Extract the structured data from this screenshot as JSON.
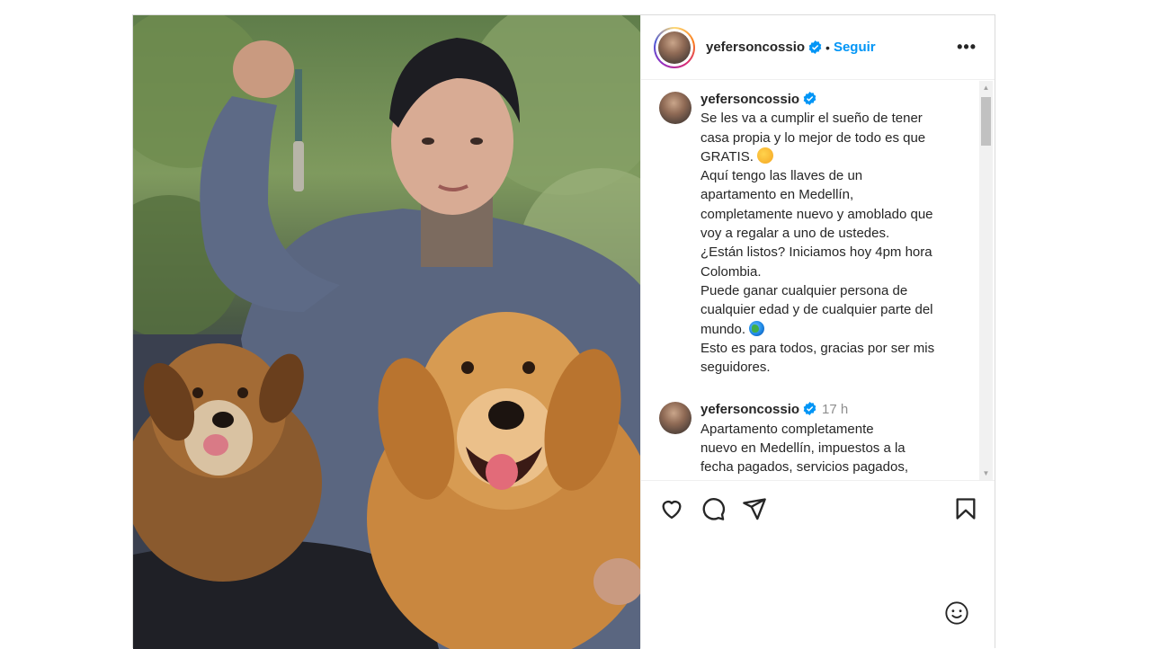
{
  "post": {
    "header": {
      "username": "yefersoncossio",
      "separator": "•",
      "follow_label": "Seguir",
      "more_label": "•••"
    },
    "caption": {
      "username": "yefersoncossio",
      "lines": [
        "Se les va a cumplir el sueño de tener",
        "casa propia y lo mejor de todo es que",
        "GRATIS.",
        "Aquí tengo las llaves de un",
        "apartamento en Medellín,",
        "completamente nuevo y amoblado que",
        "voy a regalar a uno de ustedes.",
        "¿Están listos? Iniciamos hoy 4pm hora",
        "Colombia.",
        "Puede ganar cualquier persona de",
        "cualquier edad y de cualquier parte del",
        "mundo.",
        "Esto es para todos, gracias por ser mis",
        "seguidores."
      ]
    },
    "comment": {
      "username": "yefersoncossio",
      "time": "17 h",
      "lines": [
        "Apartamento completamente",
        "nuevo en Medellín, impuestos a la",
        "fecha pagados, servicios pagados,"
      ]
    },
    "icons": {
      "verified": "verified-badge-icon",
      "like": "heart-icon",
      "comment": "comment-icon",
      "share": "share-icon",
      "save": "bookmark-icon",
      "emoji": "emoji-icon"
    },
    "colors": {
      "accent": "#0095f6",
      "text": "#262626",
      "muted": "#8e8e8e",
      "border": "#dbdbdb"
    }
  }
}
